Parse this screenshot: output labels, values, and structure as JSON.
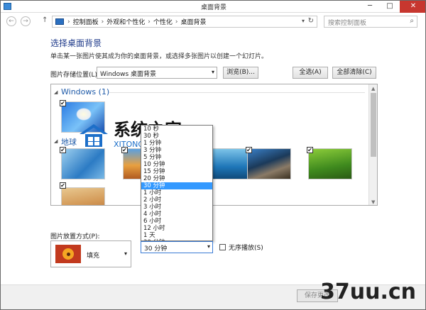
{
  "window": {
    "title": "桌面背景"
  },
  "titlebar_buttons": {
    "minimize": "─",
    "maximize": "□",
    "close": "✕"
  },
  "nav": {
    "back": "←",
    "forward": "→",
    "up": "↑"
  },
  "address": {
    "segments": [
      "控制面板",
      "外观和个性化",
      "个性化",
      "桌面背景"
    ],
    "separator": "›",
    "dropdown": "▾",
    "refresh": "↻"
  },
  "search": {
    "placeholder": "搜索控制面板",
    "icon": "⌕"
  },
  "heading": "选择桌面背景",
  "description": "单击某一张图片使其成为你的桌面背景，或选择多张图片以创建一个幻灯片。",
  "location": {
    "label": "图片存储位置(L):",
    "value": "Windows 桌面背景",
    "browse": "浏览(B)...",
    "select_all": "全选(A)",
    "clear_all": "全部清除(C)"
  },
  "gallery": {
    "groups": [
      {
        "name": "Windows (1)"
      },
      {
        "name": "地球"
      }
    ],
    "check_mark": "✔"
  },
  "position": {
    "label": "图片放置方式(P):",
    "value": "填充"
  },
  "interval": {
    "value": "30 分钟",
    "options": [
      "10 秒",
      "30 秒",
      "1 分钟",
      "3 分钟",
      "5 分钟",
      "10 分钟",
      "15 分钟",
      "20 分钟",
      "30 分钟",
      "1 小时",
      "2 小时",
      "3 小时",
      "4 小时",
      "6 小时",
      "12 小时",
      "1 天",
      "30 分钟"
    ],
    "selected_index": 8
  },
  "shuffle": {
    "label": "无序播放(S)"
  },
  "footer": {
    "save": "保存更改"
  },
  "watermarks": {
    "brand_cn": "系统之家",
    "brand_en": "XITONGZHIJIA.NET",
    "site": "37uu.cn"
  },
  "colors": {
    "heading": "#1e3a8a",
    "selection": "#3399ff",
    "close": "#c7372f",
    "group": "#1e5aa8"
  }
}
